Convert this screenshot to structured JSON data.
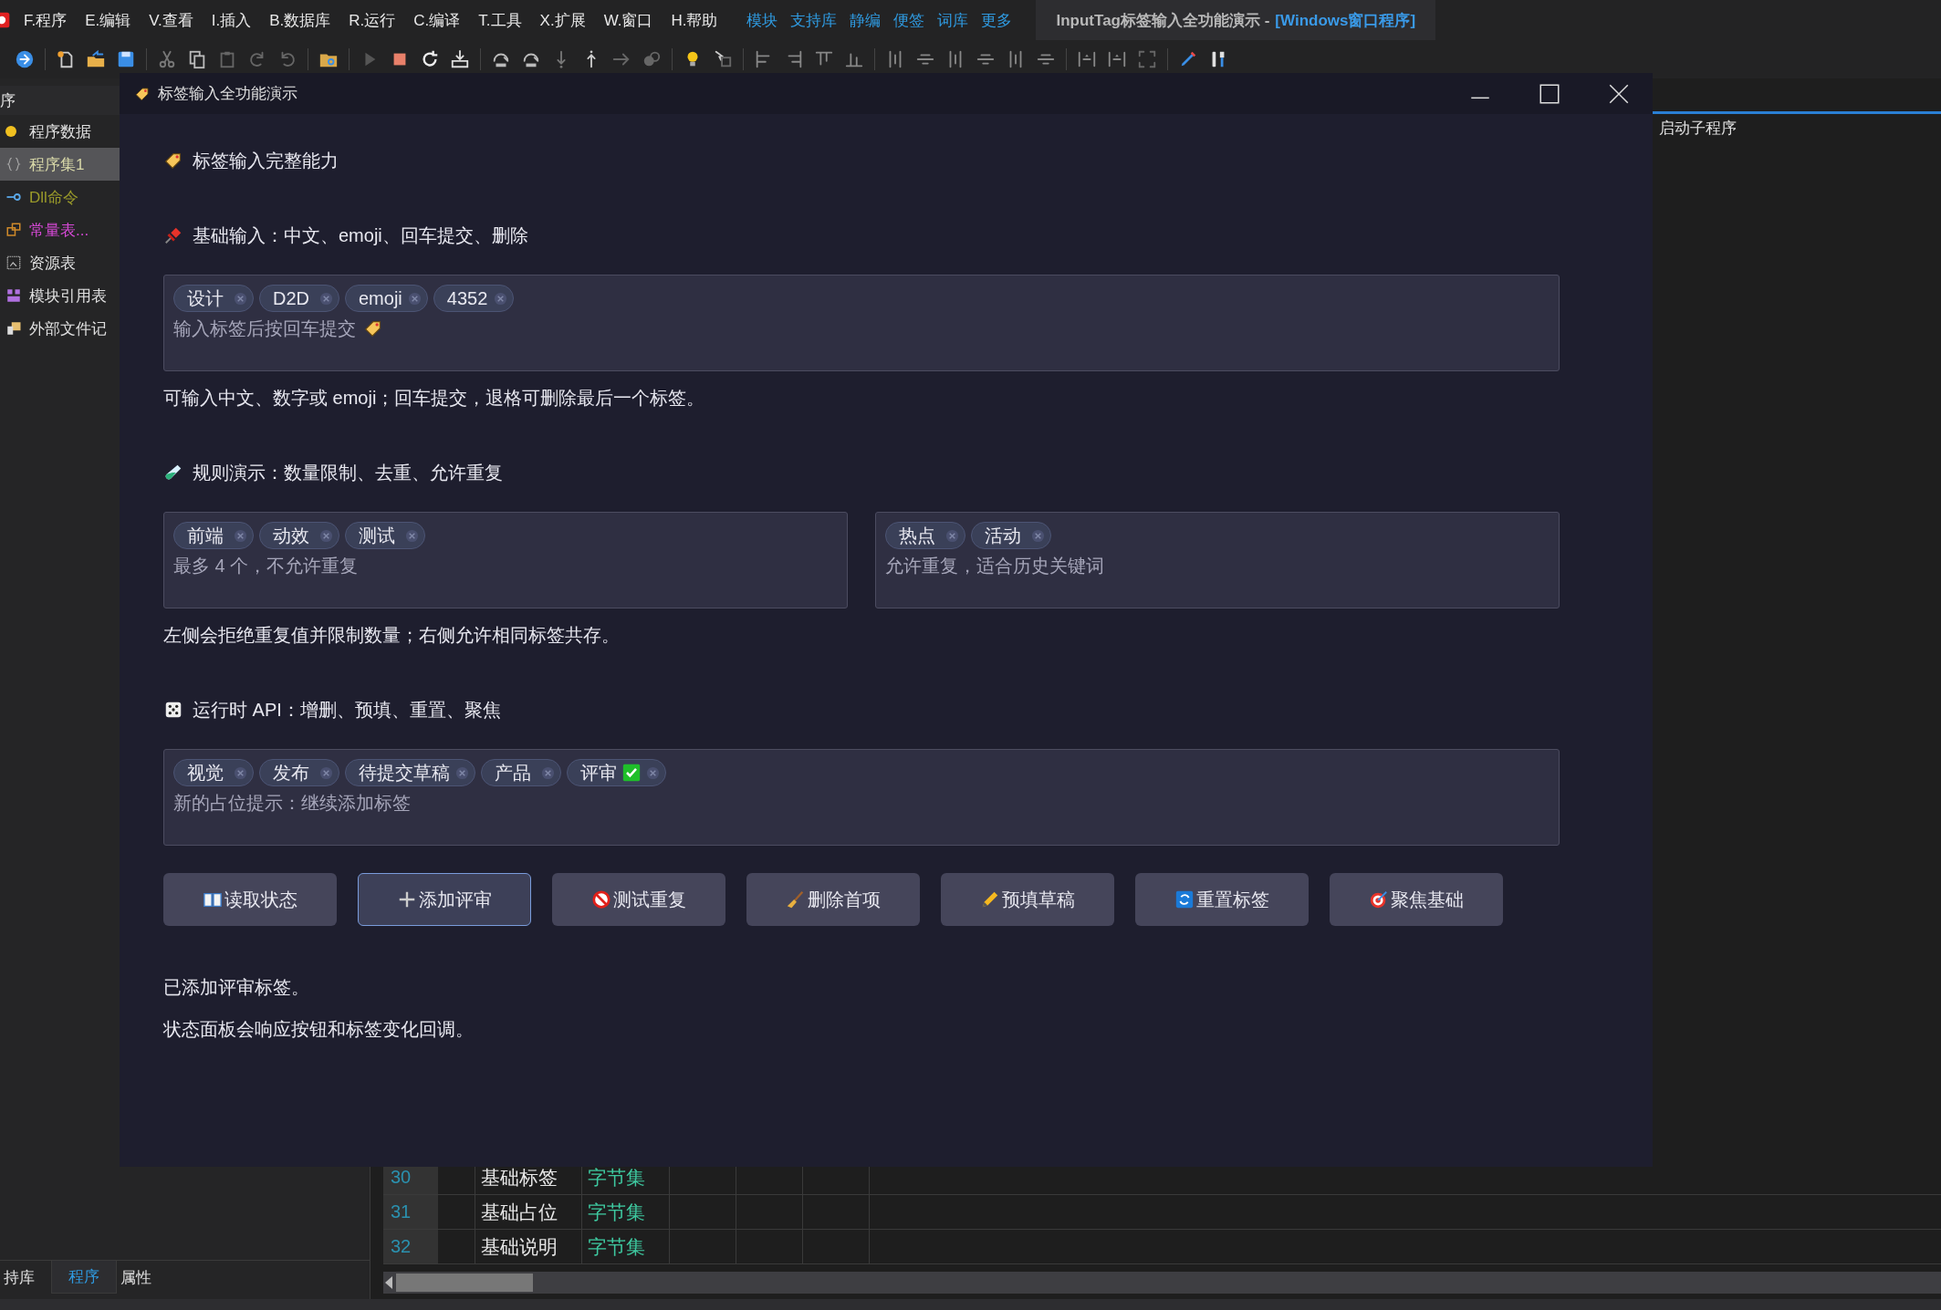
{
  "menu_bar": {
    "items": [
      "F.程序",
      "E.编辑",
      "V.查看",
      "I.插入",
      "B.数据库",
      "R.运行",
      "C.编译",
      "T.工具",
      "X.扩展",
      "W.窗口",
      "H.帮助"
    ],
    "links": [
      "模块",
      "支持库",
      "静编",
      "便签",
      "词库",
      "更多"
    ],
    "document_tab": {
      "title": "InputTag标签输入全功能演示 - ",
      "subtitle": "[Windows窗口程序]"
    }
  },
  "project_panel": {
    "title": "序",
    "items": [
      {
        "label": "程序数据",
        "kind": "circle",
        "color": "#e0e0e0",
        "selected": false
      },
      {
        "label": "程序集1",
        "kind": "braces",
        "color": "#d8d8a8",
        "selected": true
      },
      {
        "label": "Dll命令",
        "kind": "connector",
        "color": "#9a9a2a",
        "selected": false
      },
      {
        "label": "常量表...",
        "kind": "table",
        "color": "#d84ad8",
        "selected": false
      },
      {
        "label": "资源表",
        "kind": "image",
        "color": "#e0e0e0",
        "selected": false
      },
      {
        "label": "模块引用表",
        "kind": "blocks",
        "color": "#e0e0e0",
        "selected": false
      },
      {
        "label": "外部文件记",
        "kind": "files",
        "color": "#e0e0e0",
        "selected": false
      }
    ],
    "tabs": [
      {
        "label": "持库",
        "selected": false
      },
      {
        "label": "程序",
        "selected": true
      },
      {
        "label": "属性",
        "selected": false
      }
    ]
  },
  "editor": {
    "tab": "启动子程序",
    "rows": [
      {
        "line": "30",
        "name": "基础标签",
        "type": "字节集"
      },
      {
        "line": "31",
        "name": "基础占位",
        "type": "字节集"
      },
      {
        "line": "32",
        "name": "基础说明",
        "type": "字节集"
      }
    ]
  },
  "dialog": {
    "title": "标签输入全功能演示",
    "heading": "标签输入完整能力",
    "sections": [
      {
        "kind": "pin",
        "title": "基础输入：中文、emoji、回车提交、删除",
        "inputs": [
          {
            "tags": [
              {
                "label": "设计"
              },
              {
                "label": "D2D"
              },
              {
                "label": "emoji"
              },
              {
                "label": "4352"
              }
            ],
            "placeholder": "输入标签后按回车提交",
            "kind": "tag"
          }
        ],
        "note": "可输入中文、数字或 emoji；回车提交，退格可删除最后一个标签。"
      },
      {
        "kind": "testtube",
        "title": "规则演示：数量限制、去重、允许重复",
        "inputs": [
          {
            "tags": [
              {
                "label": "前端"
              },
              {
                "label": "动效"
              },
              {
                "label": "测试"
              }
            ],
            "placeholder": "最多 4 个，不允许重复"
          },
          {
            "tags": [
              {
                "label": "热点"
              },
              {
                "label": "活动"
              }
            ],
            "placeholder": "允许重复，适合历史关键词"
          }
        ],
        "note": "左侧会拒绝重复值并限制数量；右侧允许相同标签共存。"
      },
      {
        "kind": "dice",
        "title": "运行时 API：增删、预填、重置、聚焦",
        "inputs": [
          {
            "tags": [
              {
                "label": "视觉"
              },
              {
                "label": "发布"
              },
              {
                "label": "待提交草稿"
              },
              {
                "label": "产品"
              },
              {
                "label": "评审",
                "kind": "check"
              }
            ],
            "placeholder": "新的占位提示：继续添加标签"
          }
        ]
      }
    ],
    "buttons": [
      {
        "label": "读取状态",
        "kind": "book",
        "focused": false
      },
      {
        "label": "添加评审",
        "kind": "plus",
        "focused": true
      },
      {
        "label": "测试重复",
        "kind": "prohibit",
        "focused": false
      },
      {
        "label": "删除首项",
        "kind": "broom",
        "focused": false
      },
      {
        "label": "预填草稿",
        "kind": "pencil",
        "focused": false
      },
      {
        "label": "重置标签",
        "kind": "reset",
        "focused": false
      },
      {
        "label": "聚焦基础",
        "kind": "target",
        "focused": false
      }
    ],
    "status": [
      "已添加评审标签。",
      "状态面板会响应按钮和标签变化回调。"
    ]
  }
}
